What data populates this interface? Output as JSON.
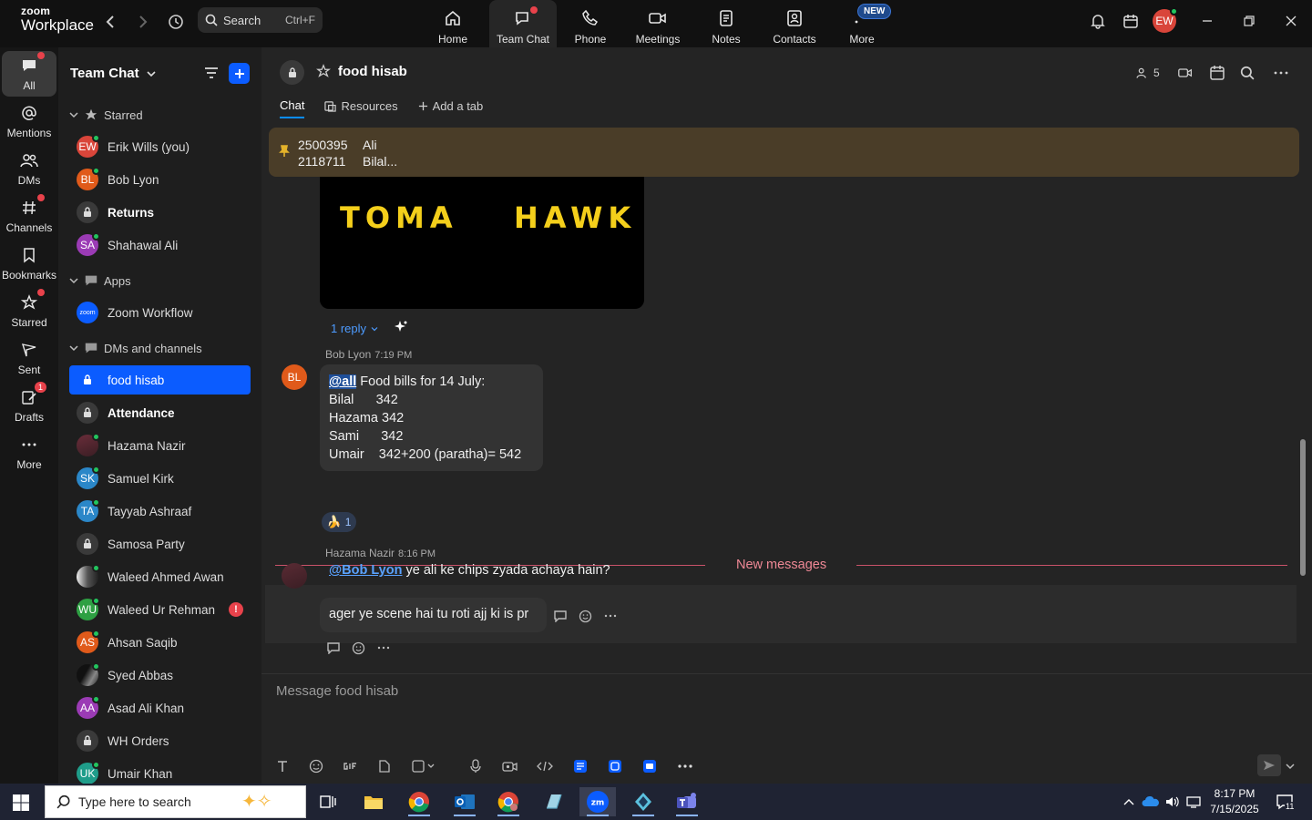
{
  "app": {
    "logo_top": "zoom",
    "logo_bottom": "Workplace",
    "search_label": "Search",
    "search_shortcut": "Ctrl+F",
    "avatar_initials": "EW"
  },
  "topnav": [
    {
      "id": "home",
      "label": "Home"
    },
    {
      "id": "team-chat",
      "label": "Team Chat"
    },
    {
      "id": "phone",
      "label": "Phone"
    },
    {
      "id": "meetings",
      "label": "Meetings"
    },
    {
      "id": "notes",
      "label": "Notes"
    },
    {
      "id": "contacts",
      "label": "Contacts"
    },
    {
      "id": "more",
      "label": "More"
    }
  ],
  "new_badge": "NEW",
  "rail": [
    {
      "label": "All"
    },
    {
      "label": "Mentions"
    },
    {
      "label": "DMs"
    },
    {
      "label": "Channels"
    },
    {
      "label": "Bookmarks"
    },
    {
      "label": "Starred"
    },
    {
      "label": "Sent"
    },
    {
      "label": "Drafts",
      "badge": "1"
    },
    {
      "label": "More"
    }
  ],
  "sidebar": {
    "title": "Team Chat",
    "sections": {
      "starred": "Starred",
      "apps": "Apps",
      "dms": "DMs and channels"
    },
    "starred": [
      {
        "name": "Erik Wills (you)",
        "initials": "EW",
        "color": "#d9453a"
      },
      {
        "name": "Bob Lyon",
        "initials": "BL",
        "color": "#e05a1a"
      },
      {
        "name": "Returns"
      },
      {
        "name": "Shahawal Ali",
        "initials": "SA",
        "color": "#9b3bb5"
      }
    ],
    "apps": [
      {
        "name": "Zoom Workflow",
        "initials": "zoom"
      }
    ],
    "dms": [
      {
        "name": "food hisab"
      },
      {
        "name": "Attendance"
      },
      {
        "name": "Hazama Nazir"
      },
      {
        "name": "Samuel Kirk",
        "initials": "SK",
        "color": "#2b87c8"
      },
      {
        "name": "Tayyab Ashraaf",
        "initials": "TA",
        "color": "#2b87c8"
      },
      {
        "name": "Samosa Party"
      },
      {
        "name": "Waleed Ahmed Awan"
      },
      {
        "name": "Waleed Ur Rehman",
        "initials": "WU",
        "color": "#2ea043",
        "alert": "!"
      },
      {
        "name": "Ahsan Saqib",
        "initials": "AS",
        "color": "#e05a1a"
      },
      {
        "name": "Syed Abbas"
      },
      {
        "name": "Asad Ali Khan",
        "initials": "AA",
        "color": "#9b3bb5"
      },
      {
        "name": "WH Orders"
      },
      {
        "name": "Umair Khan",
        "initials": "UK",
        "color": "#1f9d8a"
      }
    ]
  },
  "channel": {
    "name": "food hisab",
    "members": "5",
    "tabs": [
      {
        "label": "Chat"
      },
      {
        "label": "Resources"
      },
      {
        "label": "Add a tab"
      }
    ],
    "compose_placeholder": "Message food hisab"
  },
  "pinned": {
    "col1": [
      "2500395",
      "2118711"
    ],
    "col2": [
      "Ali",
      "Bilal..."
    ]
  },
  "image_text": {
    "left": "TOMA",
    "right": "HAWK"
  },
  "reply_label": "1 reply",
  "messages": {
    "bob": {
      "sender": "Bob Lyon",
      "time": "7:19 PM",
      "initials": "BL",
      "mention": "@all",
      "first_line": "Food bills for 14 July:",
      "lines": [
        "Bilal      342",
        "Hazama 342",
        "Sami      342",
        "Umair    342+200 (paratha)= 542"
      ],
      "reaction_count": "1"
    },
    "new_messages": "New messages",
    "hazama": {
      "sender": "Hazama Nazir",
      "time": "8:16 PM",
      "mention": "@Bob Lyon",
      "text": "ye ali ke chips zyada achaya hain?",
      "followup": "ager ye scene hai tu roti ajj ki is pr"
    }
  },
  "taskbar": {
    "search_placeholder": "Type here to search",
    "time": "8:17 PM",
    "date": "7/15/2025",
    "notif_count": "11"
  }
}
